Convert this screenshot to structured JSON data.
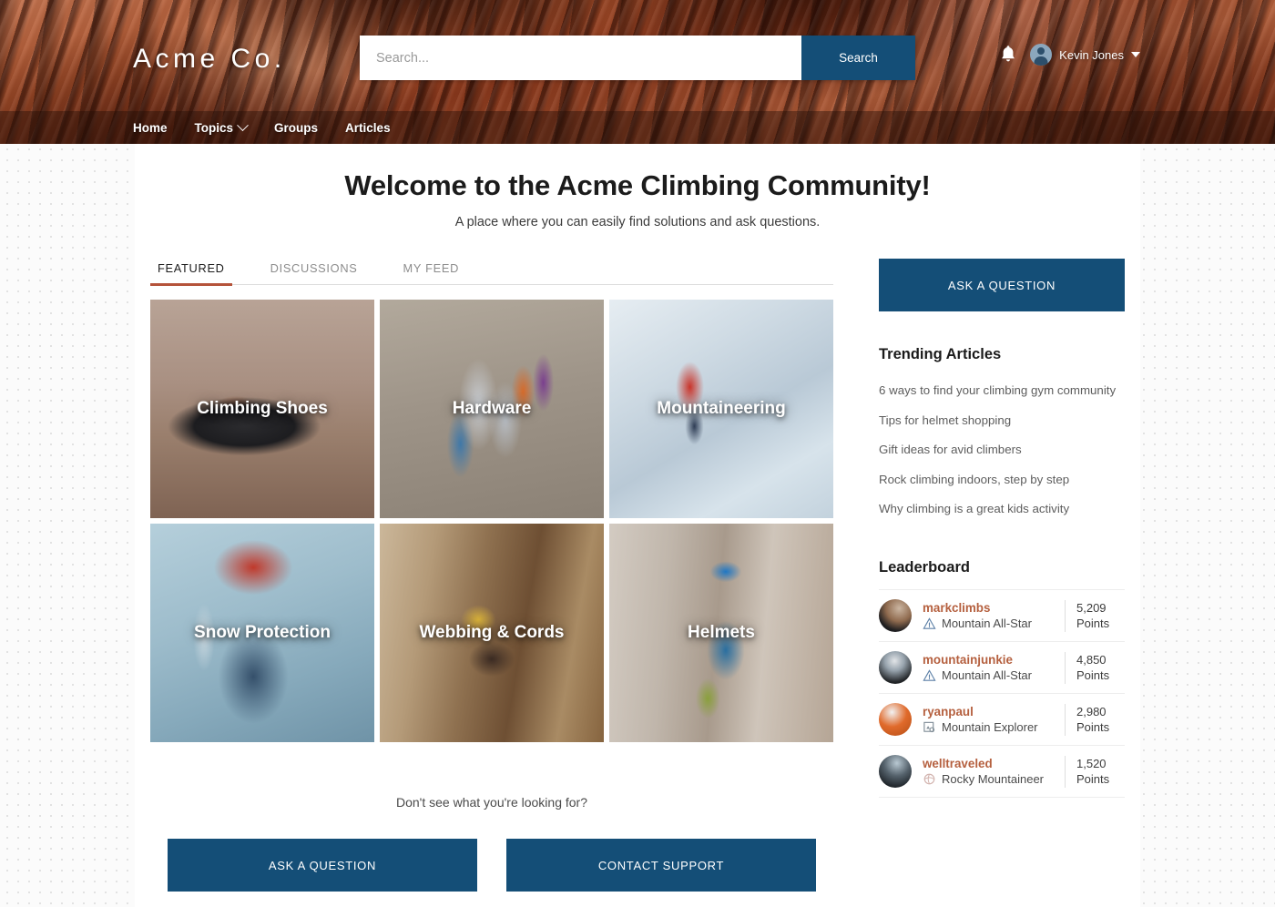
{
  "header": {
    "logo": "Acme Co.",
    "search": {
      "placeholder": "Search...",
      "value": "",
      "button_label": "Search"
    },
    "user": {
      "name": "Kevin Jones"
    },
    "nav": [
      {
        "label": "Home",
        "has_dropdown": false
      },
      {
        "label": "Topics",
        "has_dropdown": true
      },
      {
        "label": "Groups",
        "has_dropdown": false
      },
      {
        "label": "Articles",
        "has_dropdown": false
      }
    ]
  },
  "hero": {
    "title": "Welcome to the Acme Climbing Community!",
    "subtitle": "A place where you can easily find solutions and ask questions."
  },
  "tabs": [
    {
      "label": "FEATURED",
      "active": true
    },
    {
      "label": "DISCUSSIONS",
      "active": false
    },
    {
      "label": "MY FEED",
      "active": false
    }
  ],
  "tiles": [
    {
      "label": "Climbing Shoes",
      "art": "img-shoes"
    },
    {
      "label": "Hardware",
      "art": "img-hardware"
    },
    {
      "label": "Mountaineering",
      "art": "img-mountaineering"
    },
    {
      "label": "Snow Protection",
      "art": "img-snow"
    },
    {
      "label": "Webbing & Cords",
      "art": "img-webbing"
    },
    {
      "label": "Helmets",
      "art": "img-helmets"
    }
  ],
  "cta": {
    "prompt": "Don't see what you're looking for?",
    "ask_label": "ASK A QUESTION",
    "contact_label": "CONTACT SUPPORT"
  },
  "sidebar": {
    "ask_label": "ASK A QUESTION",
    "trending_heading": "Trending Articles",
    "trending": [
      "6 ways to find your climbing gym community",
      "Tips for helmet shopping",
      "Gift ideas for avid climbers",
      "Rock climbing indoors, step by step",
      "Why climbing is a great kids activity"
    ],
    "leaderboard_heading": "Leaderboard",
    "leaderboard": [
      {
        "name": "markclimbs",
        "rank": "Mountain All-Star",
        "badge": "mountain-triangle-badge-icon",
        "points": "5,209",
        "points_label": "Points"
      },
      {
        "name": "mountainjunkie",
        "rank": "Mountain All-Star",
        "badge": "mountain-triangle-badge-icon",
        "points": "4,850",
        "points_label": "Points"
      },
      {
        "name": "ryanpaul",
        "rank": "Mountain Explorer",
        "badge": "explorer-map-badge-icon",
        "points": "2,980",
        "points_label": "Points"
      },
      {
        "name": "welltraveled",
        "rank": "Rocky Mountaineer",
        "badge": "rocky-globe-badge-icon",
        "points": "1,520",
        "points_label": "Points"
      }
    ]
  },
  "colors": {
    "primary": "#144e77",
    "accent": "#b5533a",
    "link": "#b5603f",
    "header_photo": "#a8512c"
  }
}
